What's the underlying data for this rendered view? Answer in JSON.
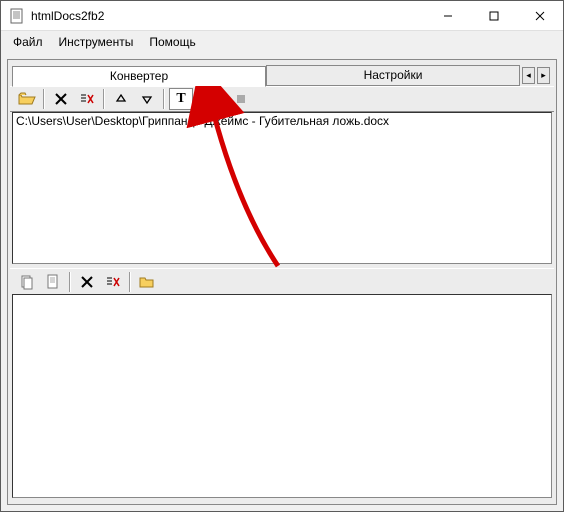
{
  "window": {
    "title": "htmlDocs2fb2"
  },
  "menu": {
    "file": "Файл",
    "tools": "Инструменты",
    "help": "Помощь"
  },
  "tabs": {
    "converter": "Конвертер",
    "settings": "Настройки"
  },
  "files": [
    "C:\\Users\\User\\Desktop\\Гриппандо Джеймс - Губительная ложь.docx"
  ],
  "icons": {
    "open": "open-icon",
    "delete": "delete-icon",
    "clear": "clear-list-icon",
    "up": "up-icon",
    "down": "down-icon",
    "text": "text-mode-icon",
    "play": "play-icon",
    "stop": "stop-icon",
    "doc1": "doc-copy-icon",
    "doc2": "doc-blank-icon",
    "del2": "delete-icon",
    "clr2": "clear-list-icon",
    "folder": "folder-icon"
  }
}
